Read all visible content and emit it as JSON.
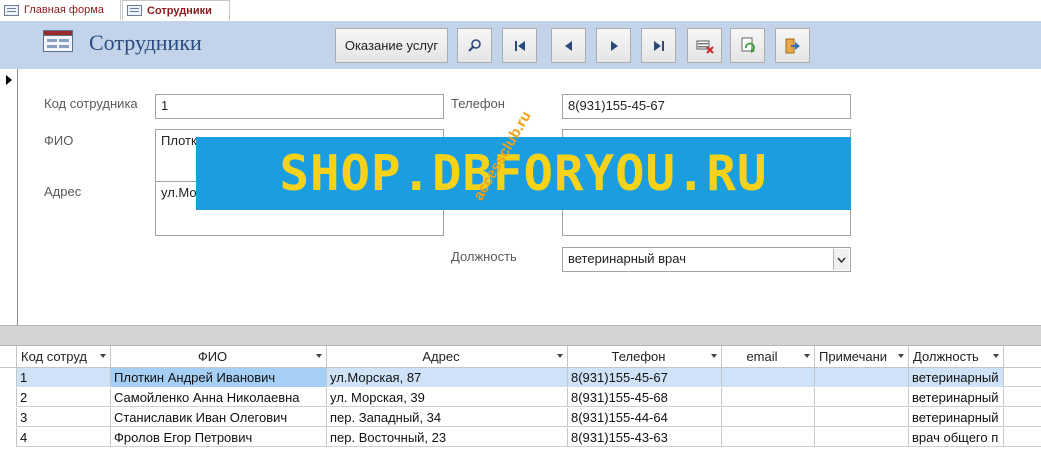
{
  "tabs": [
    {
      "label": "Главная форма",
      "active": false
    },
    {
      "label": "Сотрудники",
      "active": true
    }
  ],
  "form": {
    "title": "Сотрудники",
    "toolbar": {
      "services_label": "Оказание услуг",
      "icons": [
        "search-icon",
        "first-record-icon",
        "prev-record-icon",
        "next-record-icon",
        "last-record-icon",
        "delete-record-icon",
        "refresh-icon",
        "exit-icon"
      ]
    }
  },
  "fields": {
    "id": {
      "label": "Код сотрудника",
      "value": "1"
    },
    "fio": {
      "label": "ФИО",
      "value": "Плотк"
    },
    "address": {
      "label": "Адрес",
      "value": "ул.Мо"
    },
    "phone": {
      "label": "Телефон",
      "value": "8(931)155-45-67"
    },
    "position": {
      "label": "Должность",
      "value": "ветеринарный врач"
    }
  },
  "watermark": {
    "banner": "SHOP.DBFORYOU.RU",
    "small": "accessclub.ru",
    "banner_bg": "#1a9ee0",
    "banner_fg": "#f6d21b"
  },
  "grid": {
    "columns": [
      "Код сотруд",
      "ФИО",
      "Адрес",
      "Телефон",
      "email",
      "Примечани",
      "Должность"
    ],
    "rows": [
      [
        "1",
        "Плоткин Андрей Иванович",
        "ул.Морская, 87",
        "8(931)155-45-67",
        "",
        "",
        "ветеринарный"
      ],
      [
        "2",
        "Самойленко Анна Николаевна",
        "ул. Морская, 39",
        "8(931)155-45-68",
        "",
        "",
        "ветеринарный"
      ],
      [
        "3",
        "Станиславик Иван Олегович",
        "пер. Западный, 34",
        "8(931)155-44-64",
        "",
        "",
        "ветеринарный"
      ],
      [
        "4",
        "Фролов Егор Петрович",
        "пер. Восточный, 23",
        "8(931)155-43-63",
        "",
        "",
        "врач общего п"
      ]
    ]
  },
  "colors": {
    "header_band": "#c3d3ea",
    "title": "#2a4d7f",
    "tab_text": "#8b1a1a",
    "row_highlight": "#a6cff5"
  }
}
